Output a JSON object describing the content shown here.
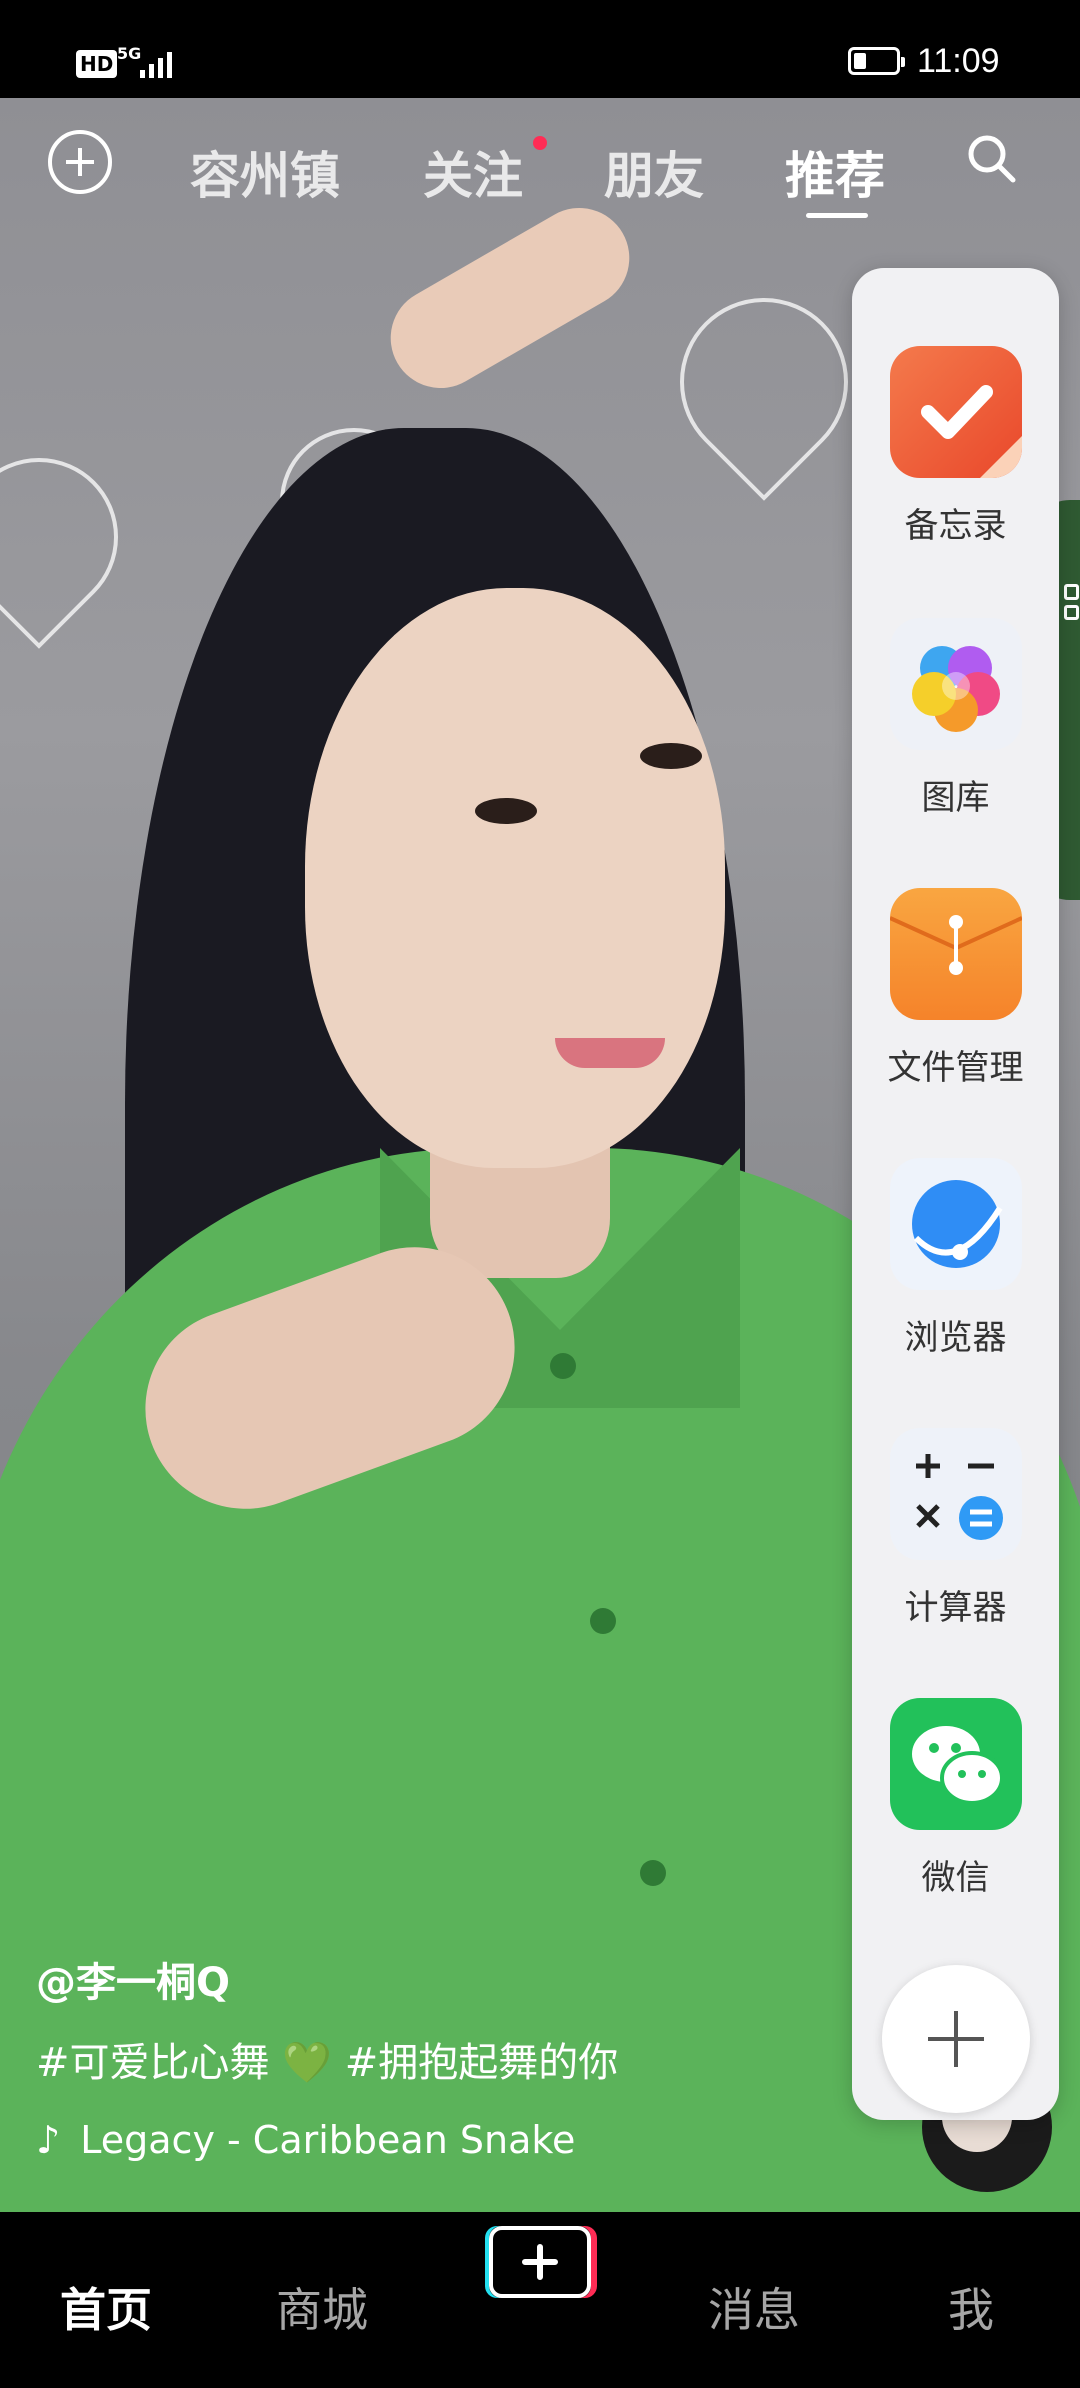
{
  "status": {
    "hd": "HD",
    "network": "5G",
    "time": "11:09"
  },
  "top_nav": {
    "tabs": [
      "容州镇",
      "关注",
      "朋友",
      "推荐"
    ],
    "active_tab": "推荐"
  },
  "dock": {
    "apps": [
      {
        "label": "备忘录",
        "icon": "notepad-icon",
        "color": "#f0643c"
      },
      {
        "label": "图库",
        "icon": "gallery-icon",
        "color": "#f5a7c8"
      },
      {
        "label": "文件管理",
        "icon": "file-manager-icon",
        "color": "#f7962e"
      },
      {
        "label": "浏览器",
        "icon": "browser-icon",
        "color": "#2f8df5"
      },
      {
        "label": "计算器",
        "icon": "calculator-icon",
        "color": "#e9f0fa"
      },
      {
        "label": "微信",
        "icon": "wechat-icon",
        "color": "#22c15a"
      }
    ]
  },
  "video": {
    "author": "@李一桐Q",
    "description": "#可爱比心舞 💚 #拥抱起舞的你",
    "music": "Legacy - Caribbean Snake"
  },
  "bottom_nav": {
    "items": [
      "首页",
      "商城",
      "消息",
      "我"
    ],
    "active": "首页"
  }
}
